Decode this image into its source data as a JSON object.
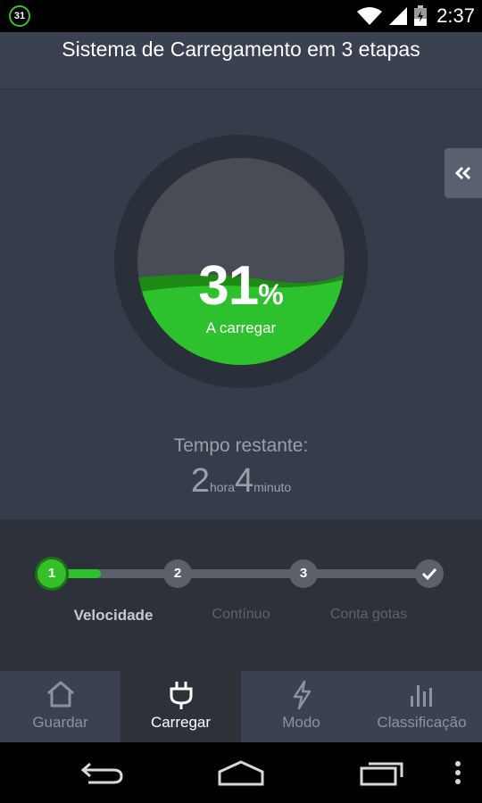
{
  "statusbar": {
    "app_badge": "31",
    "time": "2:37"
  },
  "header": {
    "title": "Sistema de Carregamento em 3 etapas"
  },
  "gauge": {
    "percent": "31",
    "percent_sign": "%",
    "status": "A carregar",
    "fill_fraction": 0.31
  },
  "remaining": {
    "label": "Tempo restante:",
    "hours": "2",
    "hours_unit": "hora",
    "minutes": "4",
    "minutes_unit": "minuto"
  },
  "steps": {
    "progress_fraction": 0.13,
    "items": [
      {
        "number": "1",
        "label": "Velocidade",
        "active": true
      },
      {
        "number": "2",
        "label": "Contínuo",
        "active": false
      },
      {
        "number": "3",
        "label": "Conta gotas",
        "active": false
      },
      {
        "number": "",
        "label": "",
        "icon": "check-icon",
        "active": false
      }
    ]
  },
  "tabs": [
    {
      "label": "Guardar",
      "icon": "home-icon",
      "active": false
    },
    {
      "label": "Carregar",
      "icon": "plug-icon",
      "active": true
    },
    {
      "label": "Modo",
      "icon": "bolt-icon",
      "active": false
    },
    {
      "label": "Classificação",
      "icon": "bar-chart-icon",
      "active": false
    }
  ],
  "colors": {
    "accent_green": "#35c02a",
    "background": "#363d4a",
    "panel": "#2c313a"
  }
}
